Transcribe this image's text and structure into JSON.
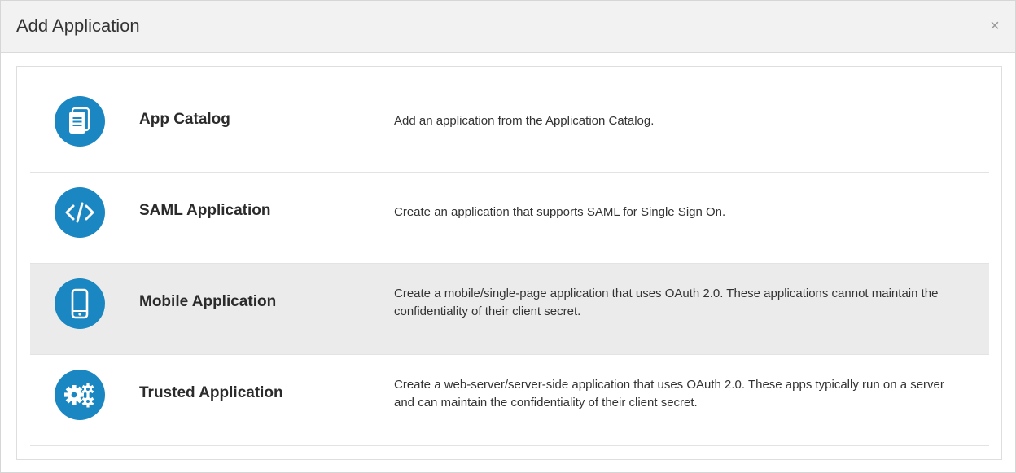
{
  "dialog": {
    "title": "Add Application",
    "close_label": "×"
  },
  "applications": [
    {
      "name": "App Catalog",
      "description": "Add an application from the Application Catalog.",
      "icon": "catalog-icon"
    },
    {
      "name": "SAML Application",
      "description": "Create an application that supports SAML for Single Sign On.",
      "icon": "code-icon"
    },
    {
      "name": "Mobile Application",
      "description": "Create a mobile/single-page application that uses OAuth 2.0. These applications cannot maintain the confidentiality of their client secret.",
      "icon": "mobile-icon",
      "selected": true
    },
    {
      "name": "Trusted Application",
      "description": "Create a web-server/server-side application that uses OAuth 2.0. These apps typically run on a server and can maintain the confidentiality of their client secret.",
      "icon": "gears-icon"
    }
  ],
  "colors": {
    "icon_background": "#1a87c2",
    "selected_row": "#ebebeb",
    "header_background": "#f2f2f2"
  }
}
